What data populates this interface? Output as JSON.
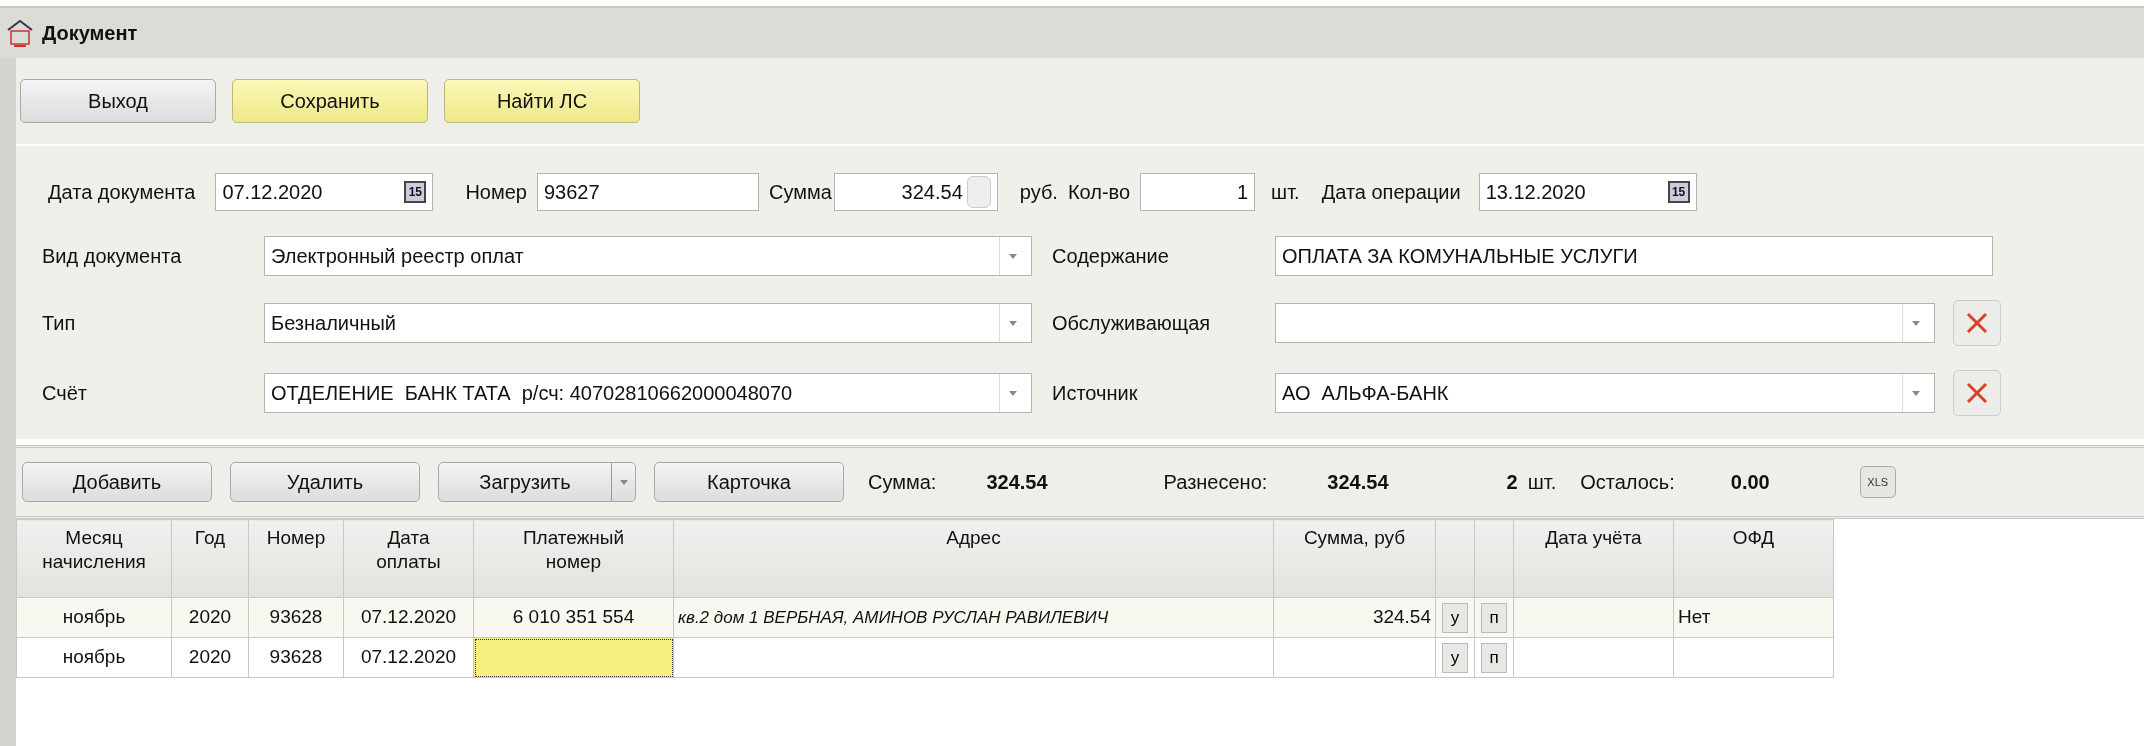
{
  "window": {
    "title": "Документ"
  },
  "toolbar": [
    {
      "label": "Выход",
      "kind": "plain"
    },
    {
      "label": "Сохранить",
      "kind": "highlight"
    },
    {
      "label": "Найти ЛС",
      "kind": "highlight"
    }
  ],
  "header_fields": [
    {
      "kind": "label",
      "text": "Дата документа"
    },
    {
      "kind": "date",
      "value": "07.12.2020",
      "picker_label": "15"
    },
    {
      "kind": "label",
      "text": "Номер"
    },
    {
      "kind": "text",
      "value": "93627"
    },
    {
      "kind": "label",
      "text": "Сумма"
    },
    {
      "kind": "spin",
      "value": "324.54"
    },
    {
      "kind": "label",
      "text": "руб."
    },
    {
      "kind": "label",
      "text": "Кол-во"
    },
    {
      "kind": "number",
      "value": "1"
    },
    {
      "kind": "label",
      "text": "шт."
    },
    {
      "kind": "label",
      "text": "Дата операции"
    },
    {
      "kind": "date",
      "value": "13.12.2020",
      "picker_label": "15"
    }
  ],
  "form_rows": [
    {
      "left": {
        "label": "Вид документа",
        "value": "Электронный реестр оплат",
        "kind": "combo"
      },
      "right": {
        "label": "Содержание",
        "value": "ОПЛАТА ЗА КОМУНАЛЬНЫЕ УСЛУГИ",
        "kind": "text",
        "clearable": false
      }
    },
    {
      "left": {
        "label": "Тип",
        "value": "Безналичный",
        "kind": "combo"
      },
      "right": {
        "label": "Обслуживающая",
        "kind": "combo",
        "clearable": true
      }
    },
    {
      "left": {
        "label": "Счёт",
        "value": "ОТДЕЛЕНИЕ  БАНК ТАТА  р/сч: 40702810662000048070",
        "kind": "combo"
      },
      "right": {
        "label": "Источник",
        "value": "АО  АЛЬФА-БАНК",
        "kind": "combo",
        "clearable": true
      }
    }
  ],
  "grid_toolbar": {
    "buttons": [
      {
        "label": "Добавить",
        "kind": "plain"
      },
      {
        "label": "Удалить",
        "kind": "plain"
      },
      {
        "label": "Загрузить",
        "kind": "split"
      },
      {
        "label": "Карточка",
        "kind": "plain"
      }
    ],
    "summary": [
      {
        "text": "Сумма:",
        "kind": "label"
      },
      {
        "text": "324.54",
        "kind": "value"
      },
      {
        "text": "Разнесено:",
        "kind": "label"
      },
      {
        "text": "324.54",
        "kind": "value"
      },
      {
        "text": "2",
        "kind": "value"
      },
      {
        "text": "шт.",
        "kind": "label"
      },
      {
        "text": "Осталось:",
        "kind": "label"
      },
      {
        "text": "0.00",
        "kind": "value"
      }
    ],
    "export_button": "XLS"
  },
  "table": {
    "columns": [
      {
        "label": "Месяц начисления",
        "kind": "center"
      },
      {
        "label": "Год",
        "kind": "center"
      },
      {
        "label": "Номер",
        "kind": "center"
      },
      {
        "label": "Дата оплаты",
        "kind": "center"
      },
      {
        "label": "Платежный номер",
        "kind": "editable"
      },
      {
        "label": "Адрес",
        "kind": "italic"
      },
      {
        "label": "Сумма, руб",
        "kind": "right"
      },
      {
        "kind": "button"
      },
      {
        "kind": "button"
      },
      {
        "label": "Дата учёта",
        "kind": "left"
      },
      {
        "label": "ОФД",
        "kind": "left"
      }
    ],
    "rows": [
      {
        "selected": false,
        "cells": [
          "ноябрь",
          "2020",
          "93628",
          "07.12.2020",
          "6 010 351 554",
          "кв.2 дом 1 ВЕРБНАЯ, АМИНОВ РУСЛАН РАВИЛЕВИЧ",
          "324.54",
          "у",
          "п",
          null,
          "Нет"
        ]
      },
      {
        "selected": true,
        "cells": [
          "ноябрь",
          "2020",
          "93628",
          "07.12.2020",
          null,
          null,
          null,
          "у",
          "п",
          null,
          null
        ]
      }
    ]
  }
}
